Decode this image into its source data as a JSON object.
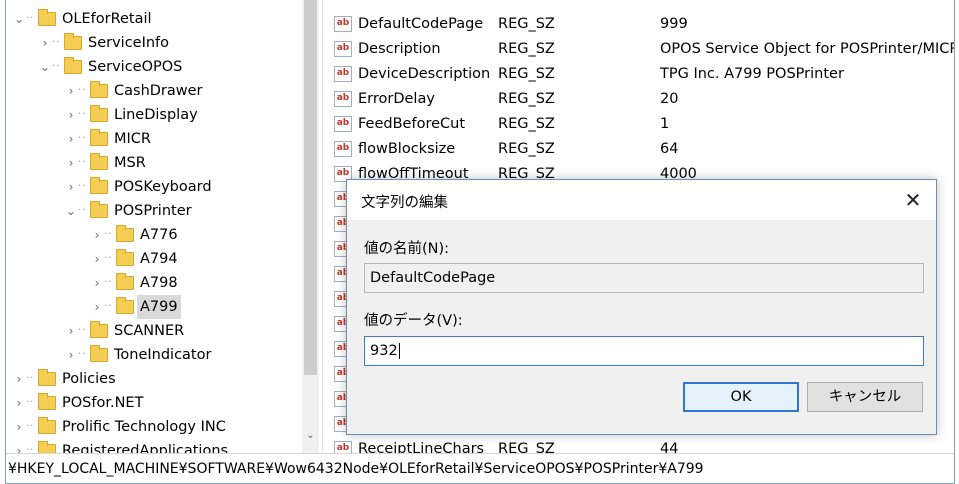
{
  "tree": {
    "items": [
      {
        "label": "OLEforRetail",
        "expander": "⌄"
      },
      {
        "label": "ServiceInfo",
        "expander": "›"
      },
      {
        "label": "ServiceOPOS",
        "expander": "⌄"
      },
      {
        "label": "CashDrawer",
        "expander": "›"
      },
      {
        "label": "LineDisplay",
        "expander": "›"
      },
      {
        "label": "MICR",
        "expander": "›"
      },
      {
        "label": "MSR",
        "expander": "›"
      },
      {
        "label": "POSKeyboard",
        "expander": "›"
      },
      {
        "label": "POSPrinter",
        "expander": "⌄"
      },
      {
        "label": "A776",
        "expander": "›"
      },
      {
        "label": "A794",
        "expander": "›"
      },
      {
        "label": "A798",
        "expander": "›"
      },
      {
        "label": "A799",
        "expander": "›",
        "selected": true
      },
      {
        "label": "SCANNER",
        "expander": "›"
      },
      {
        "label": "ToneIndicator",
        "expander": "›"
      },
      {
        "label": "Policies",
        "expander": "›"
      },
      {
        "label": "POSfor.NET",
        "expander": "›"
      },
      {
        "label": "Prolific Technology INC",
        "expander": "›"
      },
      {
        "label": "RegisteredApplications",
        "expander": "›"
      }
    ],
    "scroll_down_arrow": "⌄"
  },
  "values": {
    "rows": [
      {
        "icon": "ab",
        "name": "DefaultCodePage",
        "type": "REG_SZ",
        "data": "999"
      },
      {
        "icon": "ab",
        "name": "Description",
        "type": "REG_SZ",
        "data": "OPOS Service Object for POSPrinter/MICR/C"
      },
      {
        "icon": "ab",
        "name": "DeviceDescription",
        "type": "REG_SZ",
        "data": "TPG Inc. A799 POSPrinter"
      },
      {
        "icon": "ab",
        "name": "ErrorDelay",
        "type": "REG_SZ",
        "data": "20"
      },
      {
        "icon": "ab",
        "name": "FeedBeforeCut",
        "type": "REG_SZ",
        "data": "1"
      },
      {
        "icon": "ab",
        "name": "flowBlocksize",
        "type": "REG_SZ",
        "data": "64"
      },
      {
        "icon": "ab",
        "name": "flowOffTimeout",
        "type": "REG_SZ",
        "data": "4000"
      },
      {
        "icon": "ab",
        "name": "",
        "type": "",
        "data": ""
      },
      {
        "icon": "ab",
        "name": "",
        "type": "",
        "data": ""
      },
      {
        "icon": "ab",
        "name": "",
        "type": "",
        "data": ""
      },
      {
        "icon": "ab",
        "name": "",
        "type": "",
        "data": ""
      },
      {
        "icon": "ab",
        "name": "",
        "type": "",
        "data": ""
      },
      {
        "icon": "ab",
        "name": "",
        "type": "",
        "data": ""
      },
      {
        "icon": "ab",
        "name": "",
        "type": "",
        "data": ""
      },
      {
        "icon": "ab",
        "name": "",
        "type": "",
        "data": ""
      },
      {
        "icon": "ab",
        "name": "",
        "type": "",
        "data": ""
      },
      {
        "icon": "ab",
        "name": "",
        "type": "",
        "data": ""
      },
      {
        "icon": "ab",
        "name": "ReceiptLineChars",
        "type": "REG_SZ",
        "data": "44"
      }
    ]
  },
  "dialog": {
    "title": "文字列の編集",
    "close_glyph": "✕",
    "name_label": "値の名前(N):",
    "name_value": "DefaultCodePage",
    "data_label": "値のデータ(V):",
    "data_value": "932",
    "ok_label": "OK",
    "cancel_label": "キャンセル"
  },
  "statusbar": {
    "path": "¥HKEY_LOCAL_MACHINE¥SOFTWARE¥Wow6432Node¥OLEforRetail¥ServiceOPOS¥POSPrinter¥A799"
  },
  "colors": {
    "folder": "#f4cd55",
    "accent": "#2f76d6",
    "selection": "#d9d9d9"
  }
}
